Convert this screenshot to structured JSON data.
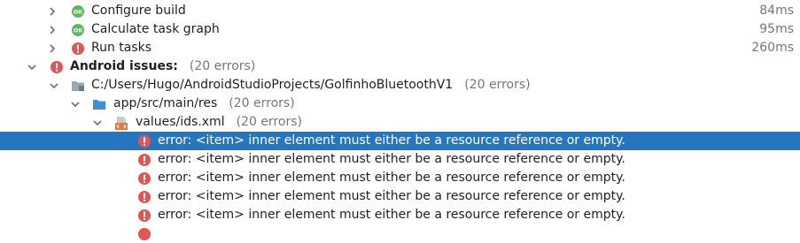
{
  "colors": {
    "selection_bg": "#2675bf",
    "error_red": "#e05555",
    "ok_green": "#5fb85f",
    "folder_blue": "#3d8fd6",
    "count_gray": "#767676"
  },
  "build_steps": [
    {
      "label": "Configure build",
      "status_icon": "ok-icon",
      "time": "84ms"
    },
    {
      "label": "Calculate task graph",
      "status_icon": "ok-icon",
      "time": "95ms"
    },
    {
      "label": "Run tasks",
      "status_icon": "error-icon",
      "time": "260ms"
    }
  ],
  "android_issues": {
    "label": "Android issues:",
    "count": "(20 errors)"
  },
  "project_path": {
    "label": "C:/Users/Hugo/AndroidStudioProjects/GolfinhoBluetoothV1",
    "count": "(20 errors)"
  },
  "res_folder": {
    "label": "app/src/main/res",
    "count": "(20 errors)"
  },
  "ids_file": {
    "label": "values/ids.xml",
    "count": "(20 errors)"
  },
  "errors": [
    {
      "message": "error: <item> inner element must either be a resource reference or empty."
    },
    {
      "message": "error: <item> inner element must either be a resource reference or empty."
    },
    {
      "message": "error: <item> inner element must either be a resource reference or empty."
    },
    {
      "message": "error: <item> inner element must either be a resource reference or empty."
    },
    {
      "message": "error: <item> inner element must either be a resource reference or empty."
    }
  ]
}
